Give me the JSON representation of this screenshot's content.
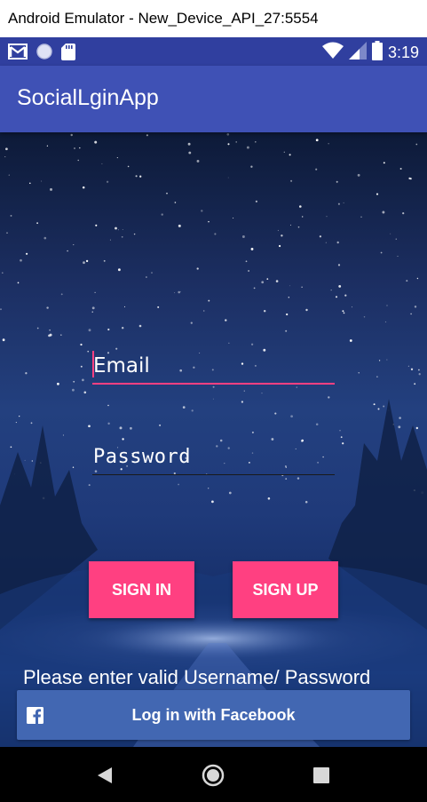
{
  "window": {
    "title": "Android Emulator - New_Device_API_27:5554"
  },
  "status_bar": {
    "time": "3:19",
    "left_icons": [
      "gmail-icon",
      "sync-circle-icon",
      "sd-card-icon"
    ],
    "right_icons": [
      "wifi-icon",
      "signal-icon",
      "battery-icon"
    ],
    "background": "#303f9f"
  },
  "app_bar": {
    "title": "SocialLginApp",
    "background": "#3f51b5"
  },
  "form": {
    "email": {
      "placeholder": "Email",
      "value": ""
    },
    "password": {
      "placeholder": "Password",
      "value": ""
    },
    "accent": "#ff4081"
  },
  "buttons": {
    "sign_in": "SIGN IN",
    "sign_up": "SIGN UP"
  },
  "message": "Please enter valid Username/ Password",
  "facebook": {
    "label": "Log in with Facebook",
    "background": "#4267b2",
    "icon": "facebook-icon"
  },
  "nav_bar": {
    "items": [
      "back-icon",
      "home-icon",
      "recents-icon"
    ]
  }
}
